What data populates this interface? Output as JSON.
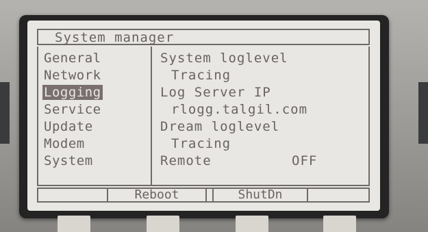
{
  "screen": {
    "title": "System manager"
  },
  "menu": {
    "items": [
      {
        "label": "General",
        "selected": false
      },
      {
        "label": "Network",
        "selected": false
      },
      {
        "label": "Logging",
        "selected": true
      },
      {
        "label": "Service",
        "selected": false
      },
      {
        "label": "Update",
        "selected": false
      },
      {
        "label": "Modem",
        "selected": false
      },
      {
        "label": "System",
        "selected": false
      }
    ]
  },
  "settings": {
    "system_loglevel_label": "System loglevel",
    "system_loglevel_value": "Tracing",
    "log_server_ip_label": "Log Server IP",
    "log_server_ip_value": "rlogg.talgil.com",
    "dream_loglevel_label": "Dream loglevel",
    "dream_loglevel_value": "Tracing",
    "remote_label": "Remote",
    "remote_value": "OFF"
  },
  "softkeys": {
    "reboot_label": "Reboot",
    "shutdown_label": "ShutDn"
  },
  "colors": {
    "lcd_background": "#e8e7e3",
    "lcd_text": "#6a6262",
    "selection_background": "#7a6f70",
    "bezel": "#242424"
  }
}
